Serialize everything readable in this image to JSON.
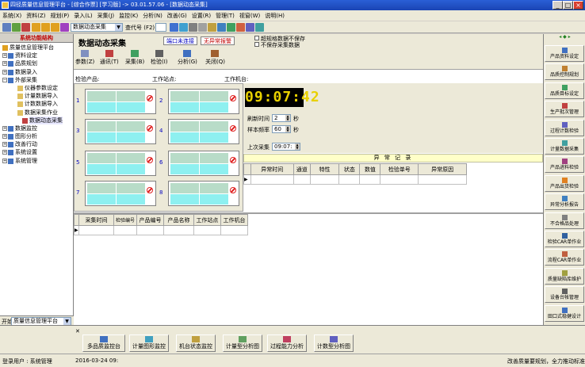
{
  "window": {
    "title": "四径质量信息管理平台 - [综合作票] [学习版]  -> 03.01.57.06 - [数据动态采集]"
  },
  "menu": [
    "系统(X)",
    "资料(Z)",
    "规划(P)",
    "录入(L)",
    "采集(J)",
    "监控(K)",
    "分析(N)",
    "改善(G)",
    "设置(R)",
    "管理(T)",
    "视窗(W)",
    "说明(H)"
  ],
  "toolbar": {
    "combo_value": "数据动态采集",
    "code_label": "查代号 (F2)"
  },
  "left_panel": {
    "title": "系统功能结构",
    "tree": [
      {
        "label": "质量信息管理平台",
        "level": 0
      },
      {
        "label": "资料设定",
        "level": 1
      },
      {
        "label": "品质规划",
        "level": 1
      },
      {
        "label": "数据录入",
        "level": 1
      },
      {
        "label": "外部采集",
        "level": 1
      },
      {
        "label": "仪器参数设定",
        "level": 2
      },
      {
        "label": "计量数据导入",
        "level": 2
      },
      {
        "label": "计数数据导入",
        "level": 2
      },
      {
        "label": "数据采集作业",
        "level": 2
      },
      {
        "label": "数据动态采集",
        "level": 3
      },
      {
        "label": "数据监控",
        "level": 1
      },
      {
        "label": "图形分析",
        "level": 1
      },
      {
        "label": "改善行动",
        "level": 1
      },
      {
        "label": "系统设置",
        "level": 1
      },
      {
        "label": "系统管理",
        "level": 1
      }
    ],
    "start_label": "开始",
    "start_combo": "质量信息管理平台"
  },
  "main": {
    "title": "数据动态采集",
    "badge_port": "端口未连接",
    "badge_alarm": "无异常报警",
    "check_1": "超规格数据不保存",
    "check_2": "不保存采集数据",
    "tools": [
      "参数(Z)",
      "通讯(T)",
      "采集(B)",
      "检验(I)",
      "分析(G)",
      "关闭(Q)"
    ],
    "product_label": "检验产品:",
    "station_label": "工作站点:",
    "machine_label": "工作机台:",
    "channels": [
      "1",
      "2",
      "3",
      "4",
      "5",
      "6",
      "7",
      "8"
    ],
    "clock": "09:07:42",
    "interval_label": "刷新时间",
    "interval_value": "2",
    "interval_unit": "秒",
    "samples_label": "样本频率",
    "samples_value": "60",
    "samples_unit": "秒",
    "last_label": "上次采集",
    "last_value": "09:07:",
    "abnormal_title": "异 常 记 录",
    "abnormal_cols": [
      "异常时间",
      "通道",
      "特性",
      "状态",
      "数值",
      "检验单号",
      "异常原因"
    ],
    "collect_cols": [
      "采集时间",
      "检验编号",
      "产品编号",
      "产品名称",
      "工作站点",
      "工作机台"
    ]
  },
  "right_panel": {
    "buttons": [
      "产品资料设定",
      "品质控制规划",
      "品质目标设定",
      "生产批次管理",
      "过程计数检验",
      "计量数据采集",
      "产品进料检验",
      "产品出货检验",
      "异常分析报告",
      "不合格品处理",
      "检验CAR单作业",
      "流程CAR单作业",
      "质量缺陷库维护",
      "设备台帐管理",
      "田口式稳健设计"
    ]
  },
  "bottom_tabs": [
    "多品质监控台",
    "计量图形监控",
    "机台状态监控",
    "计量型分析图",
    "过程能力分析",
    "计数型分析图"
  ],
  "status": {
    "user": "登录用户 : 系统管理",
    "date": "2016-03-24 09:",
    "right": "改善质量要规划，全力推动标准"
  }
}
